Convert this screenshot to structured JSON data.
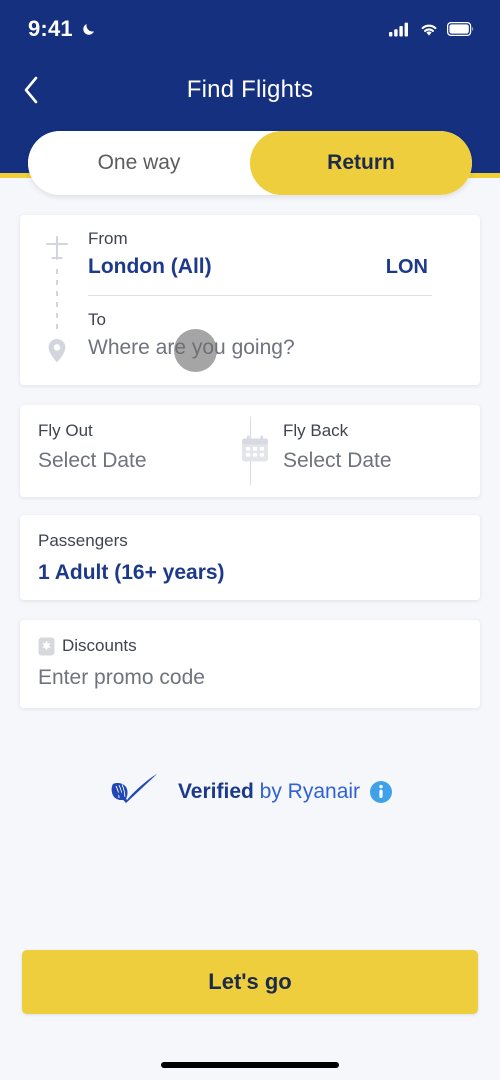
{
  "status_bar": {
    "time": "9:41",
    "dnd_icon": "crescent-moon-icon",
    "signal_icon": "cellular-signal-icon",
    "wifi_icon": "wifi-icon",
    "battery_icon": "battery-full-icon"
  },
  "header": {
    "title": "Find Flights",
    "back_icon": "chevron-left-icon",
    "bg_color": "#14307f",
    "accent_color": "#f1cf39"
  },
  "trip_type": {
    "options": [
      {
        "label": "One way",
        "selected": false
      },
      {
        "label": "Return",
        "selected": true
      }
    ],
    "selected_color": "#eece3c"
  },
  "route": {
    "origin_icon": "airplane-icon",
    "destination_icon": "map-pin-icon",
    "from_label": "From",
    "from_value": "London (All)",
    "from_code": "LON",
    "to_label": "To",
    "to_placeholder": "Where are you going?"
  },
  "dates": {
    "calendar_icon": "calendar-icon",
    "fly_out_label": "Fly Out",
    "fly_out_value": "Select Date",
    "fly_back_label": "Fly Back",
    "fly_back_value": "Select Date"
  },
  "passengers": {
    "label": "Passengers",
    "value": "1 Adult (16+ years)"
  },
  "discounts": {
    "icon": "discount-badge-icon",
    "label": "Discounts",
    "placeholder": "Enter promo code"
  },
  "verified": {
    "logo_icon": "ryanair-harp-check-icon",
    "bold_text": "Verified",
    "rest_text": " by Ryanair",
    "info_icon": "info-circle-icon",
    "info_color": "#3fa2e8",
    "brand_color": "#2f62d4"
  },
  "cta": {
    "label": "Let's go"
  },
  "home_indicator": "home-indicator-bar"
}
